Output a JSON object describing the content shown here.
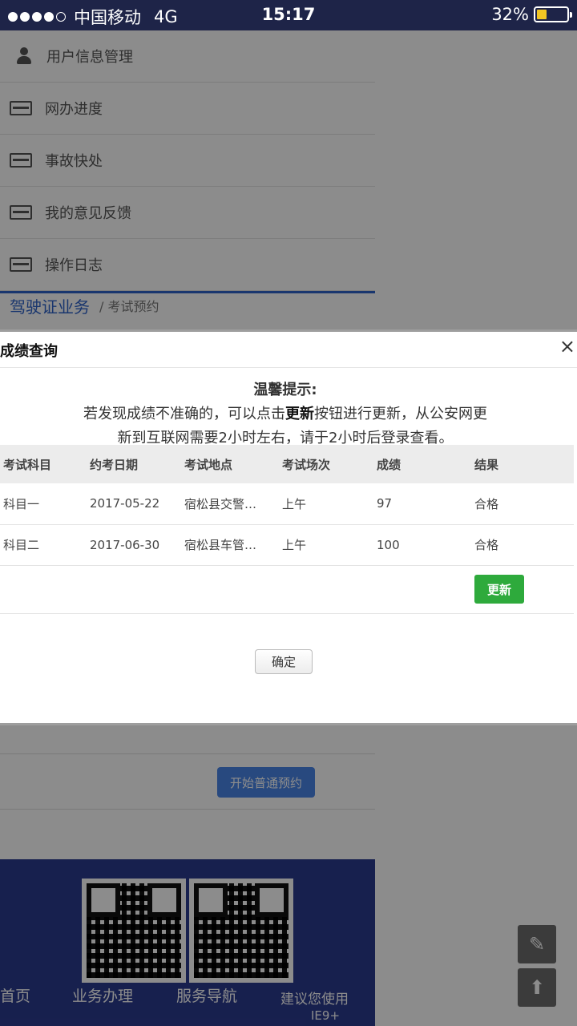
{
  "status_bar": {
    "carrier": "中国移动",
    "network": "4G",
    "time": "15:17",
    "battery": "32%",
    "battery_level": 0.32
  },
  "sidebar_menu": {
    "items": [
      {
        "label": "用户信息管理",
        "icon": "user-icon"
      },
      {
        "label": "网办进度",
        "icon": "card-icon"
      },
      {
        "label": "事故快处",
        "icon": "card-icon"
      },
      {
        "label": "我的意见反馈",
        "icon": "card-icon"
      },
      {
        "label": "操作日志",
        "icon": "card-icon"
      }
    ],
    "partial_title": "驾驶证业务",
    "partial_crumb": "/ 考试预约"
  },
  "background": {
    "start_button": "开始普通预约"
  },
  "footer": {
    "links": [
      "首页",
      "业务办理",
      "服务导航",
      "建议您使用",
      "IE9+"
    ]
  },
  "modal": {
    "title": "成绩查询",
    "notice_title": "温馨提示:",
    "notice_part1": "若发现成绩不准确的，可以点击",
    "notice_bold": "更新",
    "notice_part2": "按钮进行更新，从公安网更",
    "notice_line2": "新到互联网需要2小时左右，请于2小时后登录查看。",
    "table": {
      "headers": [
        "考试科目",
        "约考日期",
        "考试地点",
        "考试场次",
        "成绩",
        "结果"
      ],
      "rows": [
        [
          "科目一",
          "2017-05-22",
          "宿松县交警…",
          "上午",
          "97",
          "合格"
        ],
        [
          "科目二",
          "2017-06-30",
          "宿松县车管…",
          "上午",
          "100",
          "合格"
        ]
      ]
    },
    "update_button": "更新",
    "ok_button": "确定"
  },
  "colors": {
    "status_bar": "#1e2448",
    "footer": "#2b3b8f",
    "update_button": "#2eaa3c",
    "primary_blue": "#4a86e8"
  }
}
